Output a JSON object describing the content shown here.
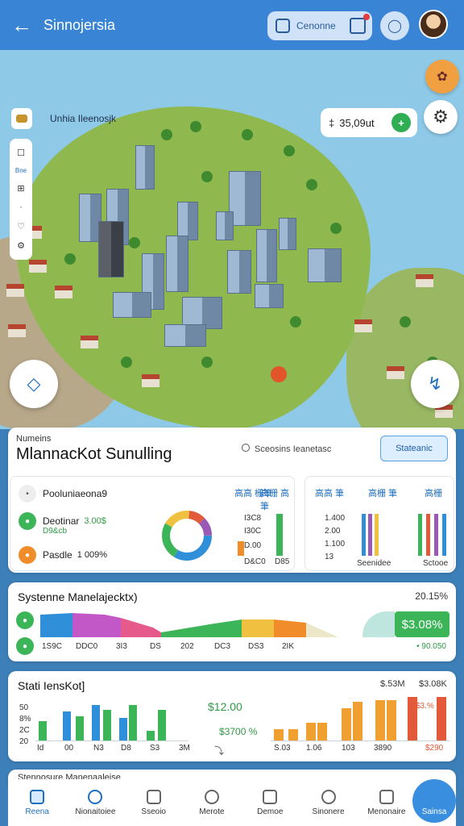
{
  "header": {
    "title": "Sinnojersia",
    "search_label": "Cenonne",
    "back_icon": "arrow-left-icon",
    "search_icon": "search-icon"
  },
  "map": {
    "label": "Unhia Ileenosjk",
    "balance": "35⁠,09ut",
    "toolbar_label": "Bne"
  },
  "simulation": {
    "kicker": "Numeins",
    "title": "MlannacKot Sunulling",
    "search_hint": "Sceosins Ieanetasc",
    "button": "Stateanic"
  },
  "overview": {
    "title": "Pooluniaeona9",
    "rows": [
      {
        "label": "Deotinar",
        "value": "3.00$",
        "sub": "D9&cb",
        "color": "#3cb558"
      },
      {
        "label": "Pasdle",
        "value": "1 009%",
        "sub": "",
        "color": "#f08c2a"
      }
    ],
    "header_links": [
      "高高 栅筆",
      "高栅 高筆"
    ],
    "bar_ticks": [
      "I3C8",
      "I30C",
      "D.00",
      "D&C0",
      "D85"
    ],
    "right_links": [
      "高高 筆",
      "高栅 筆",
      "高栅"
    ],
    "right_ticks": [
      "1.400",
      "2.00",
      "1.100",
      "13"
    ],
    "right_captions": [
      "Seenidee",
      "Sctooe"
    ]
  },
  "systems": {
    "title": "Systenne Manelajecktx)",
    "right_value": "20.15%",
    "badge": "$3.08%",
    "sub_value": "• 90.050",
    "axis": [
      "1S9C",
      "DDC0",
      "3I3",
      "DS",
      "202",
      "DC3",
      "DS3",
      "2IK"
    ]
  },
  "stats": {
    "title": "Stati IensKot]",
    "right_values": [
      "$.53M",
      "$3.08K"
    ],
    "mid_values": [
      "$12.00",
      "$3700 %"
    ],
    "right_pct": "$3.%",
    "axis_left": [
      "Id",
      "00",
      "N3",
      "D8",
      "S3",
      "3M"
    ],
    "axis_right": [
      "S.03",
      "1.06",
      "103",
      "3890",
      "$290"
    ],
    "ylabels": [
      "50",
      "8%",
      "2C",
      "20"
    ],
    "colors": [
      "#3cb558",
      "#2f8fd8",
      "#f0a030",
      "#e25a3a"
    ]
  },
  "nav": {
    "items": [
      {
        "label": "Reena",
        "icon": "home-icon",
        "active": true
      },
      {
        "label": "Nionaitoiee",
        "icon": "globe-icon",
        "active": false
      },
      {
        "label": "Sseoio",
        "icon": "grid-icon",
        "active": false
      },
      {
        "label": "Merote",
        "icon": "search-icon",
        "active": false
      },
      {
        "label": "Demoe",
        "icon": "box-icon",
        "active": false
      },
      {
        "label": "Sinonere",
        "icon": "clock-icon",
        "active": false
      },
      {
        "label": "Menonaire",
        "icon": "store-icon",
        "active": false
      }
    ],
    "fab_label": "Sainsa",
    "peek_text": "Stennosure Manenaaleise"
  }
}
